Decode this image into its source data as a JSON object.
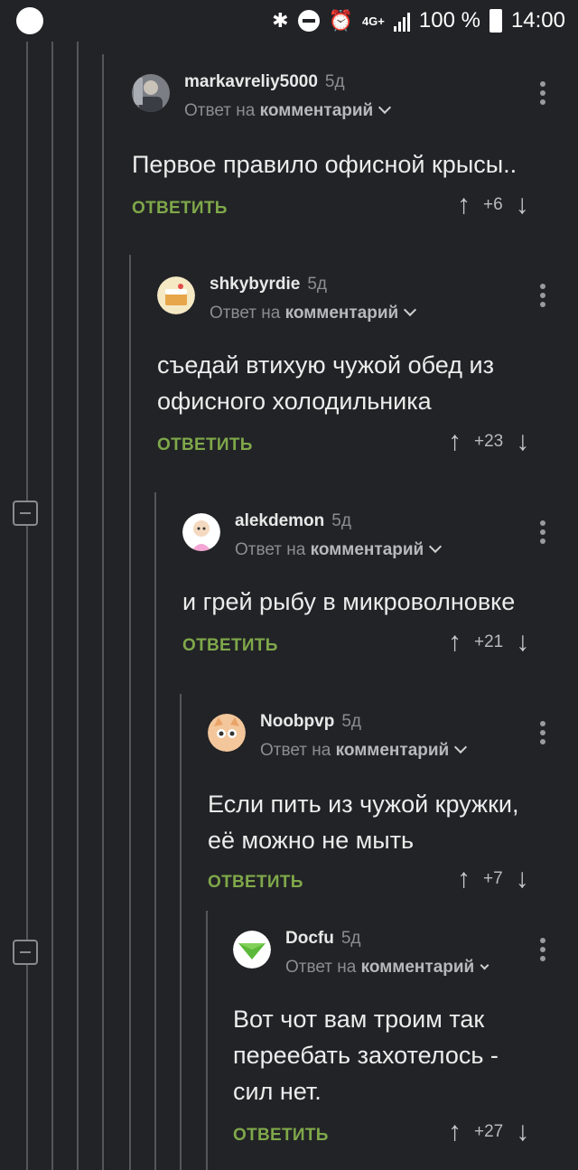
{
  "status": {
    "battery": "100 %",
    "time": "14:00",
    "network": "4G+"
  },
  "comments": [
    {
      "author": "markavreliy5000",
      "age": "5д",
      "reply_prefix": "Ответ на",
      "reply_target": "комментарий",
      "lines": [
        "Первое правило офисной крысы.."
      ],
      "reply_label": "ОТВЕТИТЬ",
      "score": "+6",
      "avatar": "photo-avatar"
    },
    {
      "author": "shkybyrdie",
      "age": "5д",
      "reply_prefix": "Ответ на",
      "reply_target": "комментарий",
      "lines": [
        "съедай втихую чужой обед из",
        "офисного холодильника"
      ],
      "reply_label": "ОТВЕТИТЬ",
      "score": "+23",
      "avatar": "cake-avatar"
    },
    {
      "author": "alekdemon",
      "age": "5д",
      "reply_prefix": "Ответ на",
      "reply_target": "комментарий",
      "lines": [
        "и грей рыбу в микроволновке"
      ],
      "reply_label": "ОТВЕТИТЬ",
      "score": "+21",
      "avatar": "girl-avatar"
    },
    {
      "author": "Noobpvp",
      "age": "5д",
      "reply_prefix": "Ответ на",
      "reply_target": "комментарий",
      "lines": [
        "Если пить из чужой кружки,",
        "её можно не мыть"
      ],
      "reply_label": "ОТВЕТИТЬ",
      "score": "+7",
      "avatar": "cat-avatar"
    },
    {
      "author": "Docfu",
      "age": "5д",
      "reply_prefix": "Ответ на",
      "reply_target": "комментарий",
      "lines": [
        "Вот чот вам троим так",
        "переебать захотелось -",
        "сил нет."
      ],
      "reply_label": "ОТВЕТИТЬ",
      "score": "+27",
      "avatar": "green-triangle-avatar"
    }
  ]
}
